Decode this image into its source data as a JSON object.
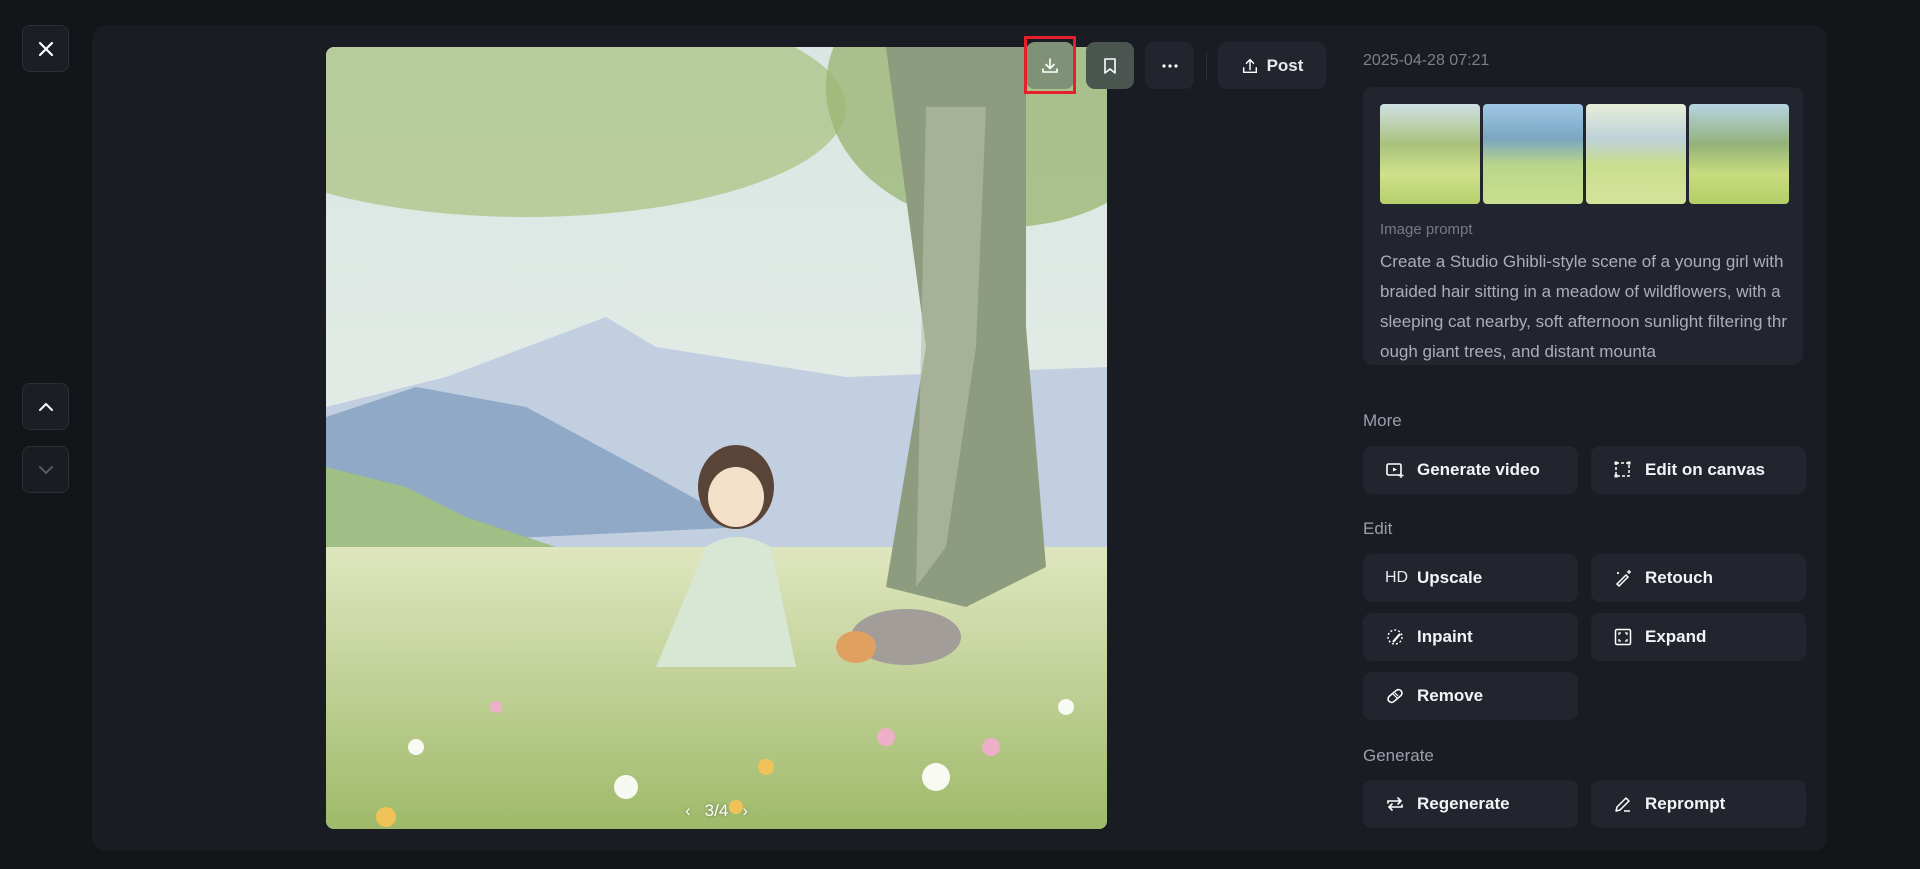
{
  "toolbar": {
    "post_label": "Post",
    "icons": [
      "download-icon",
      "bookmark-icon",
      "more-icon",
      "upload-icon"
    ]
  },
  "image": {
    "page": "3/4"
  },
  "info": {
    "timestamp": "2025-04-28 07:21",
    "prompt_label": "Image prompt",
    "prompt_text": "Create a Studio Ghibli-style scene of a young girl with braided hair sitting in a meadow of wildflowers, with a sleeping cat nearby, soft afternoon sunlight filtering through giant trees, and distant mounta"
  },
  "sections": {
    "more": "More",
    "edit": "Edit",
    "generate": "Generate"
  },
  "actions": {
    "generate_video": "Generate video",
    "edit_canvas": "Edit on canvas",
    "upscale_badge": "HD",
    "upscale": "Upscale",
    "retouch": "Retouch",
    "inpaint": "Inpaint",
    "expand": "Expand",
    "remove": "Remove",
    "regenerate": "Regenerate",
    "reprompt": "Reprompt"
  },
  "colors": {
    "highlight": "#e5202a",
    "panel": "#1a1c23",
    "button": "#22252d"
  }
}
